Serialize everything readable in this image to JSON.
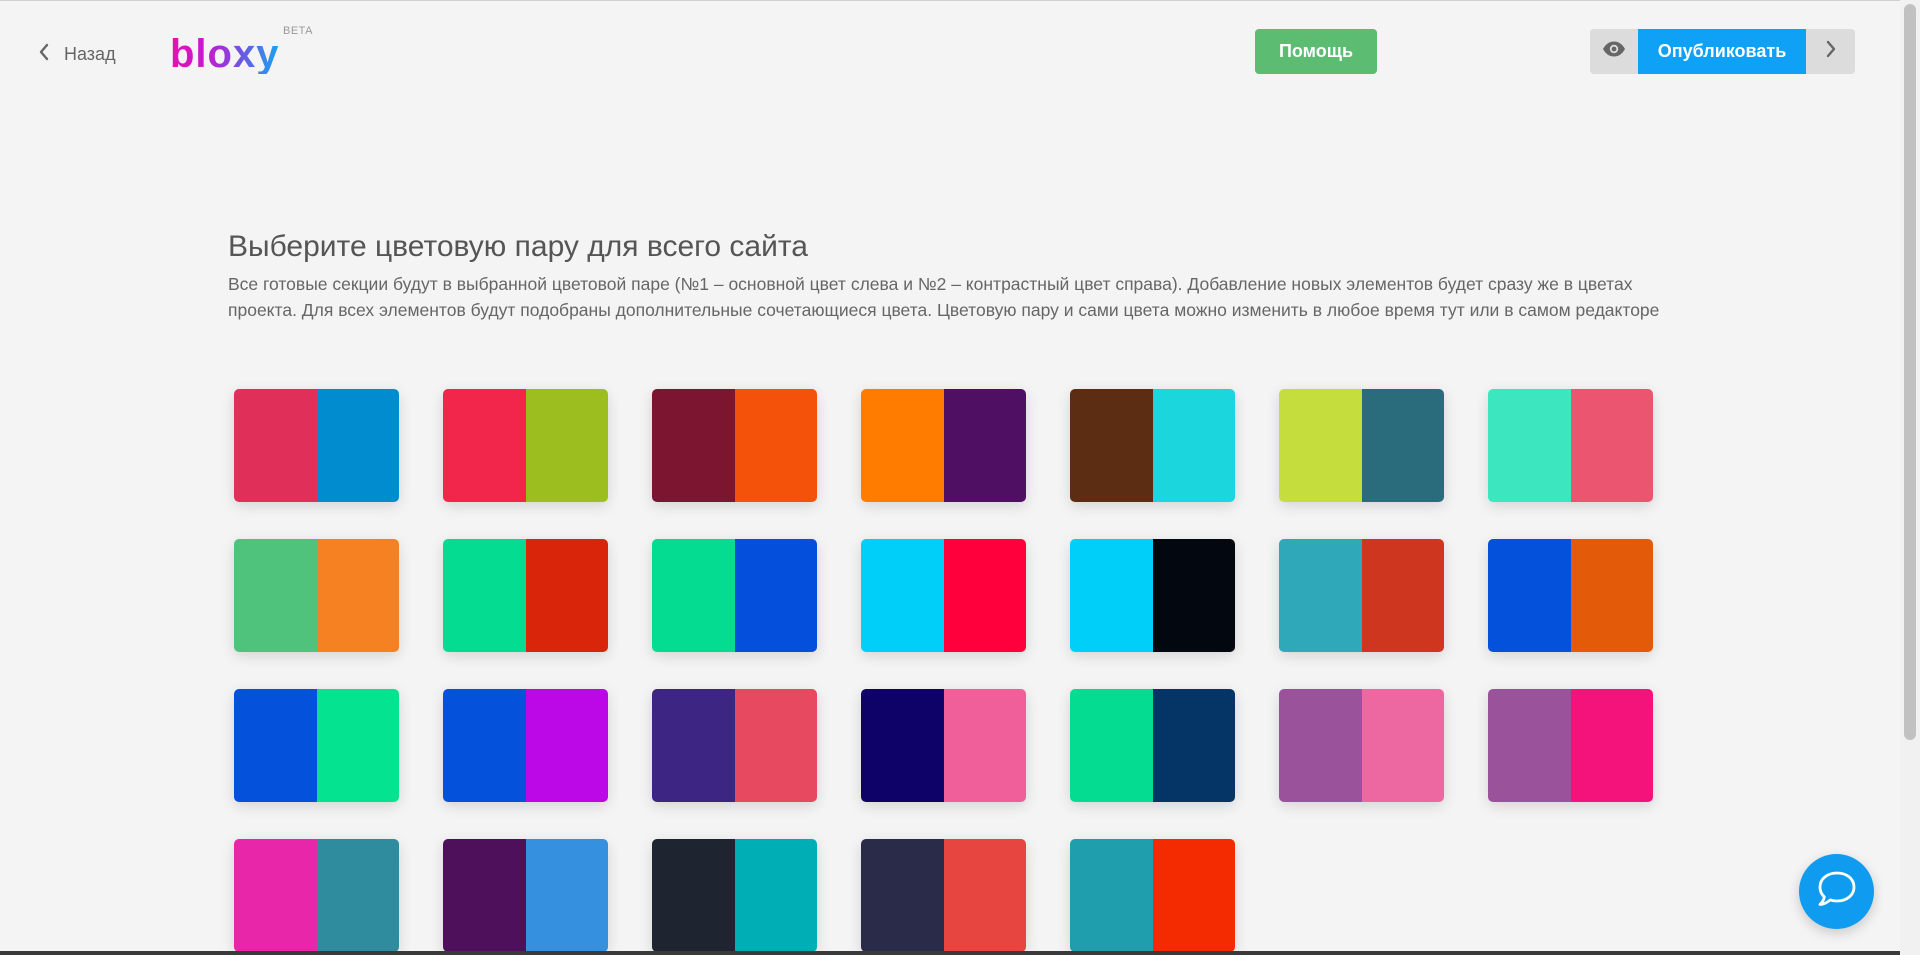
{
  "header": {
    "back_label": "Назад",
    "logo_text": "bloxy",
    "logo_badge": "BETA",
    "help_label": "Помощь",
    "publish_label": "Опубликовать"
  },
  "content": {
    "title": "Выберите цветовую пару для всего сайта",
    "description": "Все готовые секции будут в выбранной цветовой паре (№1 – основной цвет слева и №2 – контрастный цвет справа). Добавление новых элементов будет сразу же в цветах проекта. Для всех элементов будут подобраны дополнительные сочетающиеся цвета. Цветовую пару и сами цвета можно изменить в любое время тут или в самом редакторе"
  },
  "color_pairs": [
    [
      "#e0305a",
      "#008ccf"
    ],
    [
      "#f2254a",
      "#9cbf1f"
    ],
    [
      "#7c1530",
      "#f4520a"
    ],
    [
      "#ff7c00",
      "#4f1064"
    ],
    [
      "#5c2c13",
      "#1bd6dd"
    ],
    [
      "#c5dd3d",
      "#2a6b7c"
    ],
    [
      "#3ce6bf",
      "#ec5570"
    ],
    [
      "#4fc37b",
      "#f68122"
    ],
    [
      "#04dc92",
      "#d9260a"
    ],
    [
      "#04dc92",
      "#044fdc"
    ],
    [
      "#00cffa",
      "#ff003c"
    ],
    [
      "#00cffa",
      "#03070f"
    ],
    [
      "#2fa8ba",
      "#ce361f"
    ],
    [
      "#0451dc",
      "#e35b08"
    ],
    [
      "#0451dc",
      "#04e390"
    ],
    [
      "#0451dc",
      "#bc07e7"
    ],
    [
      "#3c2583",
      "#e74a60"
    ],
    [
      "#0e0268",
      "#f15f9b"
    ],
    [
      "#04dc92",
      "#043566"
    ],
    [
      "#9a539b",
      "#ed67a1"
    ],
    [
      "#9a539b",
      "#f3137b"
    ],
    [
      "#e726aa",
      "#2e8c9e"
    ],
    [
      "#4f105b",
      "#3590e0"
    ],
    [
      "#1f2530",
      "#00aeb6"
    ],
    [
      "#292b49",
      "#e6463f"
    ],
    [
      "#1f9fad",
      "#f52b00"
    ]
  ],
  "colors": {
    "help_button": "#5cbc72",
    "publish_button": "#0ea1f5",
    "chat_button": "#0f9cf0"
  },
  "icons": {
    "back": "chevron-left-icon",
    "preview": "eye-icon",
    "next": "chevron-right-icon",
    "chat": "chat-bubble-icon"
  }
}
